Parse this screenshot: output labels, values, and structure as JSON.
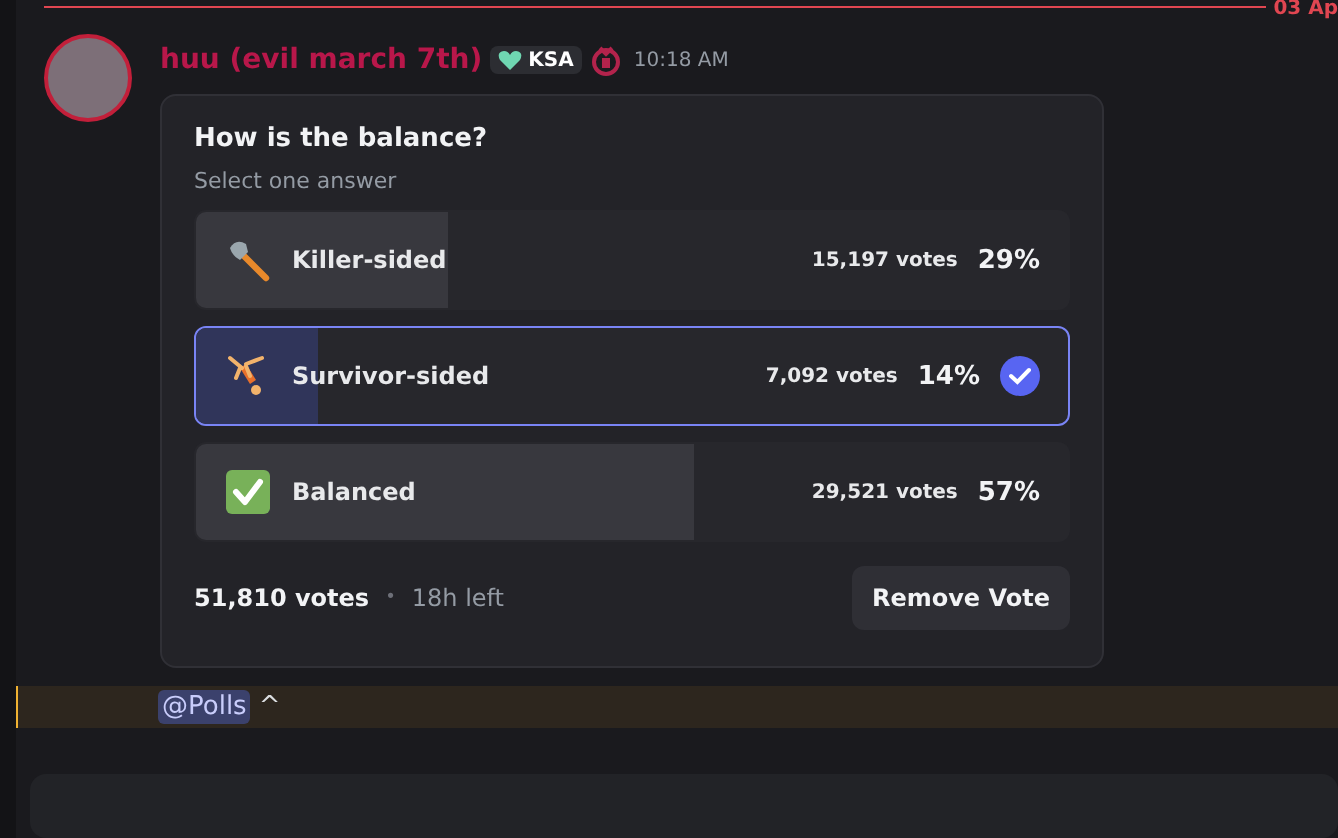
{
  "divider": {
    "date": "03 Ap"
  },
  "message": {
    "author": "huu (evil march 7th)",
    "tag": "KSA",
    "time": "10:18 AM"
  },
  "poll": {
    "question": "How is the balance?",
    "hint": "Select one answer",
    "options": [
      {
        "label": "Killer-sided",
        "votes": "15,197 votes",
        "percent": "29%",
        "level": 0.29,
        "selected": false
      },
      {
        "label": "Survivor-sided",
        "votes": "7,092 votes",
        "percent": "14%",
        "level": 0.14,
        "selected": true
      },
      {
        "label": "Balanced",
        "votes": "29,521 votes",
        "percent": "57%",
        "level": 0.57,
        "selected": false
      }
    ],
    "total": "51,810 votes",
    "separator": "•",
    "time_left": "18h left",
    "button": "Remove Vote"
  },
  "mention_message": {
    "mention": "@Polls",
    "text": "^"
  }
}
